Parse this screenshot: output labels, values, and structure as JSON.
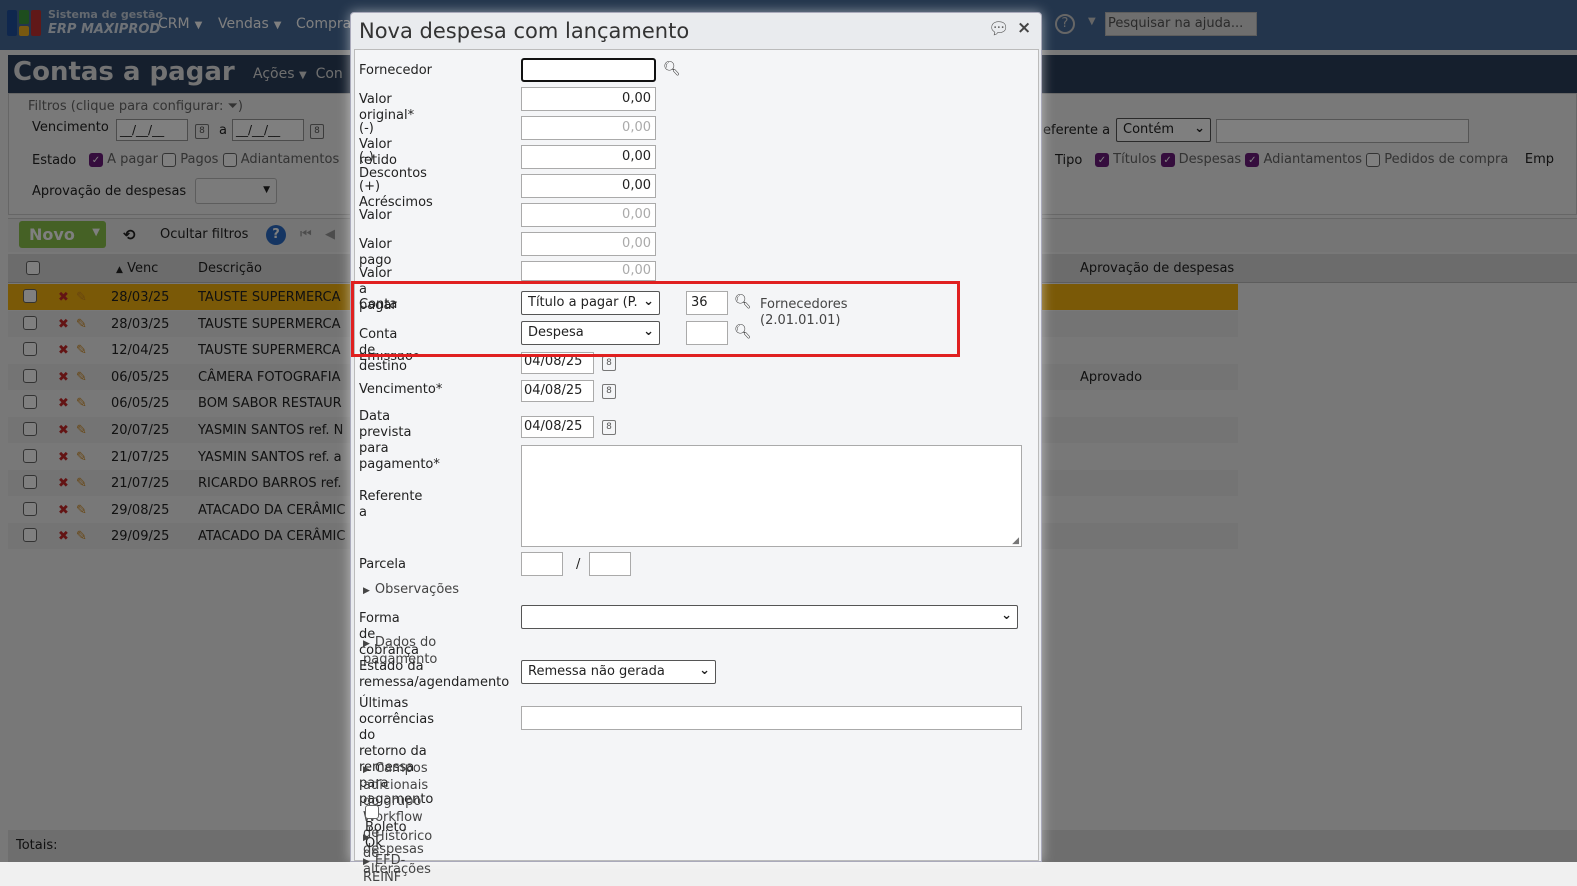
{
  "app": {
    "logo_line1": "Sistema de gestão",
    "logo_line2": "ERP MAXIPROD",
    "menu": [
      "CRM",
      "Vendas",
      "Compras"
    ],
    "help_search_placeholder": "Pesquisar na ajuda..."
  },
  "page": {
    "title": "Contas a pagar",
    "actions": "Ações",
    "actions2": "Con"
  },
  "filters": {
    "legend": "Filtros (clique para configurar:",
    "legend_end": ")",
    "vencimento": "Vencimento",
    "date_placeholder": "__/__/__",
    "a": "a",
    "estado": "Estado",
    "estado_opts": [
      {
        "label": "A pagar",
        "checked": true
      },
      {
        "label": "Pagos",
        "checked": false
      },
      {
        "label": "Adiantamentos",
        "checked": false
      }
    ],
    "aprovacao": "Aprovação de despesas",
    "referente": "eferente a",
    "referente_op": "Contém",
    "tipo": "Tipo",
    "tipo_opts": [
      {
        "label": "Títulos",
        "checked": true
      },
      {
        "label": "Despesas",
        "checked": true
      },
      {
        "label": "Adiantamentos",
        "checked": true
      },
      {
        "label": "Pedidos de compra",
        "checked": false
      }
    ],
    "emp": "Emp"
  },
  "toolbar": {
    "novo": "Novo",
    "ocultar": "Ocultar filtros"
  },
  "table": {
    "headers": {
      "venc": "Venc",
      "descricao": "Descrição",
      "aprovacao": "Aprovação de despesas"
    },
    "rows": [
      {
        "venc": "28/03/25",
        "desc": "TAUSTE SUPERMERCA",
        "aprov": ""
      },
      {
        "venc": "28/03/25",
        "desc": "TAUSTE SUPERMERCA",
        "aprov": ""
      },
      {
        "venc": "12/04/25",
        "desc": "TAUSTE SUPERMERCA",
        "aprov": ""
      },
      {
        "venc": "06/05/25",
        "desc": "CÂMERA FOTOGRAFIA",
        "aprov": "Aprovado"
      },
      {
        "venc": "06/05/25",
        "desc": "BOM SABOR RESTAUR",
        "aprov": ""
      },
      {
        "venc": "20/07/25",
        "desc": "YASMIN SANTOS ref. N",
        "aprov": ""
      },
      {
        "venc": "21/07/25",
        "desc": "YASMIN SANTOS ref. a",
        "aprov": ""
      },
      {
        "venc": "21/07/25",
        "desc": "RICARDO BARROS ref.",
        "aprov": ""
      },
      {
        "venc": "29/08/25",
        "desc": "ATACADO DA CERÂMIC",
        "aprov": ""
      },
      {
        "venc": "29/09/25",
        "desc": "ATACADO DA CERÂMIC",
        "aprov": ""
      }
    ],
    "totais": "Totais:"
  },
  "dialog": {
    "title": "Nova despesa com lançamento",
    "fornecedor": "Fornecedor",
    "valor_original": {
      "label": "Valor original*",
      "value": "0,00"
    },
    "valor_retido": {
      "label": "(-) Valor retido",
      "value": "0,00"
    },
    "descontos": {
      "label": "(-) Descontos",
      "value": "0,00"
    },
    "acrescimos": {
      "label": "(+) Acréscimos",
      "value": "0,00"
    },
    "valor": {
      "label": "Valor",
      "value": "0,00"
    },
    "valor_pago": {
      "label": "Valor pago",
      "value": "0,00"
    },
    "valor_a_pagar": {
      "label": "Valor a pagar",
      "value": "0,00"
    },
    "conta": {
      "label": "Conta",
      "select": "Título a pagar (P.",
      "code": "36",
      "desc": "Fornecedores (2.01.01.01)"
    },
    "conta_destino": {
      "label": "Conta de destino",
      "select": "Despesa",
      "code": ""
    },
    "emissao": {
      "label": "Emissão*",
      "value": "04/08/25"
    },
    "vencimento": {
      "label": "Vencimento*",
      "value": "04/08/25"
    },
    "data_prevista": {
      "label1": "Data prevista para",
      "label2": "pagamento*",
      "value": "04/08/25"
    },
    "referente": "Referente a",
    "parcela": "Parcela",
    "parcela_sep": "/",
    "observacoes": "Observações",
    "forma_cobranca": "Forma de cobrança",
    "dados_pagamento": "Dados do pagamento",
    "estado_remessa": {
      "label1": "Estado da",
      "label2": "remessa/agendamento",
      "value": "Remessa não gerada"
    },
    "ultimas": {
      "label1": "Últimas ocorrências do",
      "label2": "retorno da remessa",
      "label3": "para pagamento"
    },
    "campos_adicionais": "Campos adicionais do grupo Workflow de despesas",
    "boleto_ok": "Boleto Ok",
    "historico": "Histórico de alterações",
    "efd": "EFD-REINF"
  },
  "colors": {
    "highlight": "#e02020",
    "selected_row": "#f5b20f",
    "novo": "#8bc34a"
  }
}
